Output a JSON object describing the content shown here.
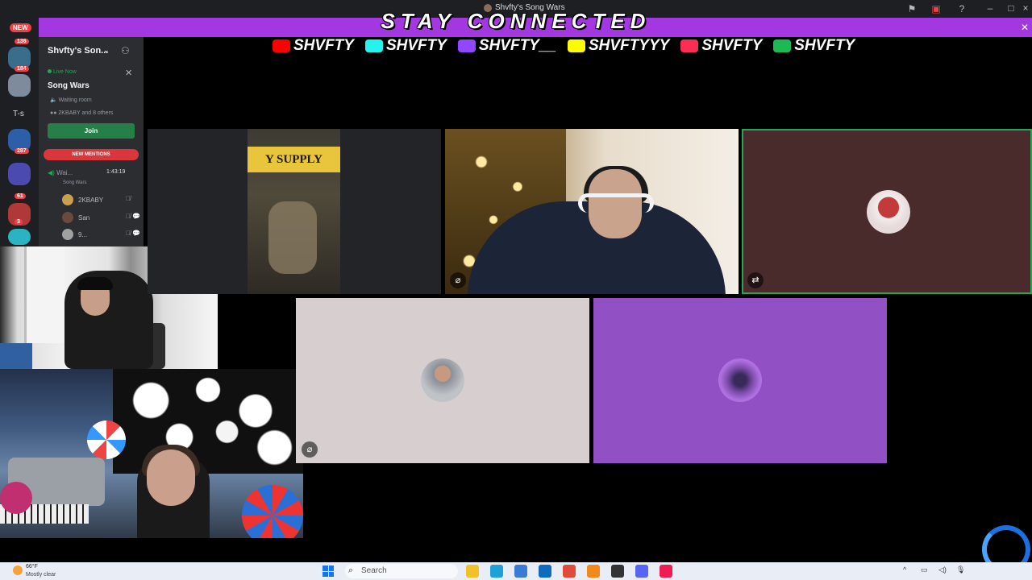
{
  "window": {
    "title": "Shvfty's Song Wars"
  },
  "banner": {
    "text": "STAY CONNECTED"
  },
  "socials": [
    {
      "platform": "youtube",
      "handle": "SHVFTY",
      "color": "#ff0000"
    },
    {
      "platform": "tiktok",
      "handle": "SHVFTY",
      "color": "#25f4ee"
    },
    {
      "platform": "twitch",
      "handle": "SHVFTY__",
      "color": "#9146ff"
    },
    {
      "platform": "snapchat",
      "handle": "SHVFTYYY",
      "color": "#fffc00"
    },
    {
      "platform": "apple-music",
      "handle": "SHVFTY",
      "color": "#fa2d55"
    },
    {
      "platform": "spotify",
      "handle": "SHVFTY",
      "color": "#1db954"
    }
  ],
  "rail": {
    "new_label": "NEW",
    "badges": [
      "136",
      "184",
      "287",
      "61",
      "3"
    ],
    "text_server": "T-s"
  },
  "sidebar": {
    "server_name": "Shvfty's Son...",
    "live_label": "Live Now",
    "stage_name": "Song Wars",
    "waiting_room": "Waiting room",
    "others": "2KBABY and 8 others",
    "join_label": "Join",
    "mentions_label": "NEW MENTIONS",
    "voice_channel": "Wai...",
    "voice_time": "1:43:19",
    "voice_sub": "Song Wars",
    "members": [
      {
        "name": "2KBABY",
        "color": "#c9a050"
      },
      {
        "name": "San",
        "color": "#6a4a3a"
      },
      {
        "name": "9...",
        "color": "#a0a0a0"
      }
    ]
  },
  "tiles": {
    "a": {
      "sign_text": "Y SUPPLY"
    }
  },
  "taskbar": {
    "temperature": "66°F",
    "weather": "Mostly clear",
    "search_label": "Search",
    "apps": [
      {
        "name": "file-explorer",
        "color": "#f2c028"
      },
      {
        "name": "edge",
        "color": "#1ea1d6"
      },
      {
        "name": "store",
        "color": "#3a7bd5"
      },
      {
        "name": "outlook",
        "color": "#0f6cbd"
      },
      {
        "name": "chrome",
        "color": "#e04a3a"
      },
      {
        "name": "vlc",
        "color": "#f08a1c"
      },
      {
        "name": "obs",
        "color": "#333333"
      },
      {
        "name": "discord",
        "color": "#5865f2"
      },
      {
        "name": "tiktok",
        "color": "#ee1d52"
      }
    ]
  },
  "colors": {
    "banner": "#a338e0",
    "join": "#248046",
    "mention": "#da373c",
    "speaking": "#23a55a"
  }
}
